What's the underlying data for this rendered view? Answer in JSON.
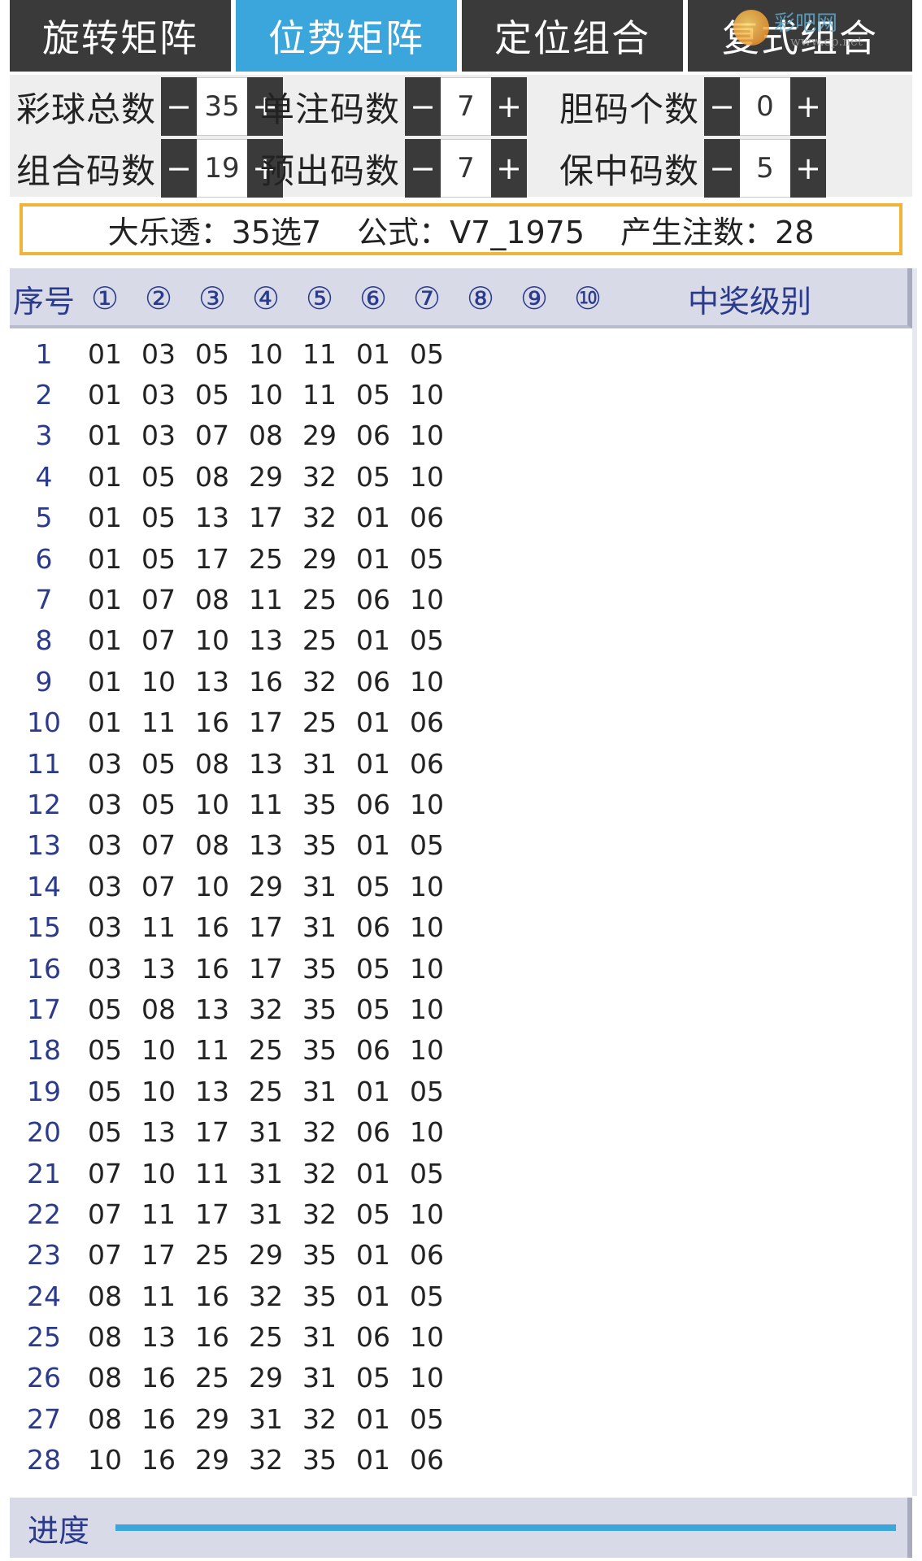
{
  "tabs": [
    {
      "label": "旋转矩阵",
      "active": false
    },
    {
      "label": "位势矩阵",
      "active": true
    },
    {
      "label": "定位组合",
      "active": false
    },
    {
      "label": "复式组合",
      "active": false
    }
  ],
  "watermark": {
    "text": "彩吧网",
    "url": "www.cp.net"
  },
  "params": [
    {
      "label": "彩球总数",
      "value": "35"
    },
    {
      "label": "单注码数",
      "value": "7"
    },
    {
      "label": "胆码个数",
      "value": "0"
    },
    {
      "label": "组合码数",
      "value": "19"
    },
    {
      "label": "预出码数",
      "value": "7"
    },
    {
      "label": "保中码数",
      "value": "5"
    }
  ],
  "stepper": {
    "minus": "−",
    "plus": "+"
  },
  "summary": {
    "lottery": "大乐透：35选7",
    "formula": "公式：V7_1975",
    "count": "产生注数：28"
  },
  "table": {
    "headers": [
      "序号",
      "①",
      "②",
      "③",
      "④",
      "⑤",
      "⑥",
      "⑦",
      "⑧",
      "⑨",
      "⑩",
      "中奖级别"
    ],
    "rows": [
      [
        "1",
        "01",
        "03",
        "05",
        "10",
        "11",
        "01",
        "05"
      ],
      [
        "2",
        "01",
        "03",
        "05",
        "10",
        "11",
        "05",
        "10"
      ],
      [
        "3",
        "01",
        "03",
        "07",
        "08",
        "29",
        "06",
        "10"
      ],
      [
        "4",
        "01",
        "05",
        "08",
        "29",
        "32",
        "05",
        "10"
      ],
      [
        "5",
        "01",
        "05",
        "13",
        "17",
        "32",
        "01",
        "06"
      ],
      [
        "6",
        "01",
        "05",
        "17",
        "25",
        "29",
        "01",
        "05"
      ],
      [
        "7",
        "01",
        "07",
        "08",
        "11",
        "25",
        "06",
        "10"
      ],
      [
        "8",
        "01",
        "07",
        "10",
        "13",
        "25",
        "01",
        "05"
      ],
      [
        "9",
        "01",
        "10",
        "13",
        "16",
        "32",
        "06",
        "10"
      ],
      [
        "10",
        "01",
        "11",
        "16",
        "17",
        "25",
        "01",
        "06"
      ],
      [
        "11",
        "03",
        "05",
        "08",
        "13",
        "31",
        "01",
        "06"
      ],
      [
        "12",
        "03",
        "05",
        "10",
        "11",
        "35",
        "06",
        "10"
      ],
      [
        "13",
        "03",
        "07",
        "08",
        "13",
        "35",
        "01",
        "05"
      ],
      [
        "14",
        "03",
        "07",
        "10",
        "29",
        "31",
        "05",
        "10"
      ],
      [
        "15",
        "03",
        "11",
        "16",
        "17",
        "31",
        "06",
        "10"
      ],
      [
        "16",
        "03",
        "13",
        "16",
        "17",
        "35",
        "05",
        "10"
      ],
      [
        "17",
        "05",
        "08",
        "13",
        "32",
        "35",
        "05",
        "10"
      ],
      [
        "18",
        "05",
        "10",
        "11",
        "25",
        "35",
        "06",
        "10"
      ],
      [
        "19",
        "05",
        "10",
        "13",
        "25",
        "31",
        "01",
        "05"
      ],
      [
        "20",
        "05",
        "13",
        "17",
        "31",
        "32",
        "06",
        "10"
      ],
      [
        "21",
        "07",
        "10",
        "11",
        "31",
        "32",
        "01",
        "05"
      ],
      [
        "22",
        "07",
        "11",
        "17",
        "31",
        "32",
        "05",
        "10"
      ],
      [
        "23",
        "07",
        "17",
        "25",
        "29",
        "35",
        "01",
        "06"
      ],
      [
        "24",
        "08",
        "11",
        "16",
        "32",
        "35",
        "01",
        "05"
      ],
      [
        "25",
        "08",
        "13",
        "16",
        "25",
        "31",
        "06",
        "10"
      ],
      [
        "26",
        "08",
        "16",
        "25",
        "29",
        "31",
        "05",
        "10"
      ],
      [
        "27",
        "08",
        "16",
        "29",
        "31",
        "32",
        "01",
        "05"
      ],
      [
        "28",
        "10",
        "16",
        "29",
        "32",
        "35",
        "01",
        "06"
      ]
    ]
  },
  "progress": {
    "label": "进度",
    "value": 1.0
  },
  "colors": {
    "accent": "#3aa6dc",
    "tab_bg": "#3a3a3a",
    "header_text": "#2a3a8c",
    "summary_border": "#f0b43a"
  }
}
